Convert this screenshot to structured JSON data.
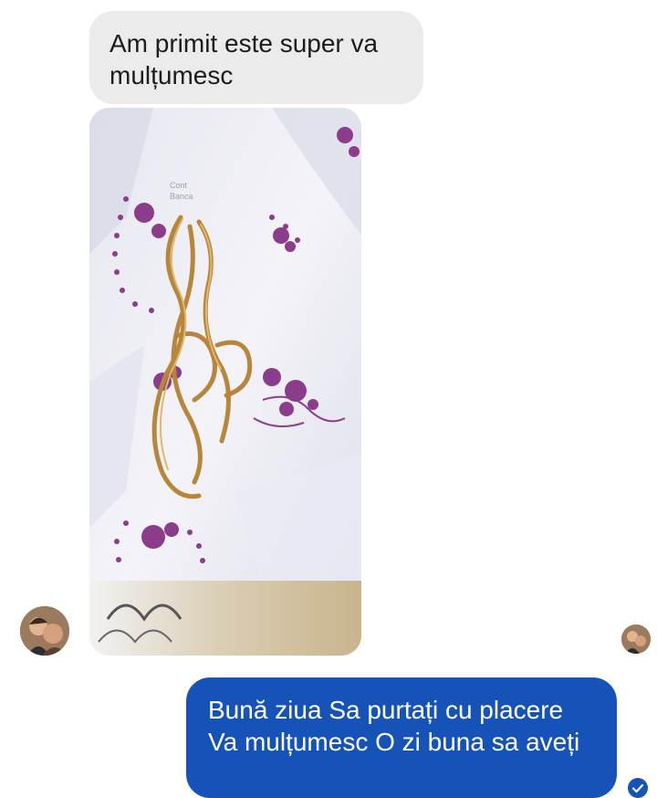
{
  "conversation": {
    "incoming_message": "Am  primit este super va mulțumesc",
    "outgoing_message": "Bună ziua Sa purtați cu placere Va mulțumesc O zi buna sa aveți"
  },
  "attachment": {
    "receipt_text_line1": "Cont",
    "receipt_text_line2": "Banca"
  },
  "colors": {
    "incoming_bubble": "#ebebeb",
    "outgoing_bubble": "#1653b8",
    "flower_purple": "#8b3d8c",
    "chain_gold": "#b8863a"
  },
  "icons": {
    "sender_avatar": "avatar-photo",
    "receiver_avatar": "avatar-photo",
    "seen_status": "check-circle-icon"
  }
}
